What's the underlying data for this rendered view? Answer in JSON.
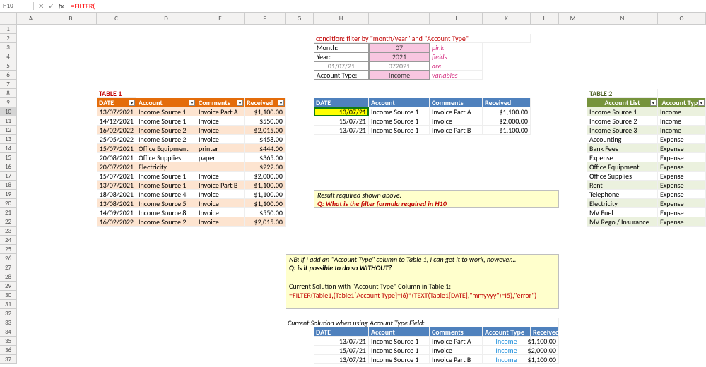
{
  "namebox": "H10",
  "formula": "=FILTER(",
  "cols": [
    "A",
    "B",
    "C",
    "D",
    "E",
    "F",
    "G",
    "H",
    "I",
    "J",
    "K",
    "L",
    "M",
    "N",
    "O"
  ],
  "rows": [
    "1",
    "2",
    "3",
    "4",
    "5",
    "6",
    "7",
    "8",
    "9",
    "10",
    "11",
    "12",
    "13",
    "14",
    "15",
    "16",
    "17",
    "18",
    "19",
    "20",
    "21",
    "22",
    "23",
    "24",
    "25",
    "26",
    "27",
    "28",
    "29",
    "30",
    "31",
    "32",
    "33",
    "34",
    "35",
    "36",
    "37"
  ],
  "condition_title": "condition: filter by \"month/year\" and \"Account Type\"",
  "cond": {
    "month_label": "Month:",
    "month_val": "07",
    "note1": "pink",
    "year_label": "Year:",
    "year_val": "2021",
    "note2": "fields",
    "date_label": "01/07/21",
    "date_val": "072021",
    "note3": "are",
    "acct_label": "Account Type:",
    "acct_val": "Income",
    "note4": "variables"
  },
  "t1": {
    "title": "TABLE 1",
    "hdr": {
      "date": "DATE",
      "acct": "Account",
      "com": "Comments",
      "rec": "Received"
    },
    "rows": [
      {
        "d": "13/07/2021",
        "a": "Income Source 1",
        "c": "Invoice Part A",
        "r": "$1,100.00"
      },
      {
        "d": "14/12/2021",
        "a": "Income Source 1",
        "c": "Invoice",
        "r": "$550.00"
      },
      {
        "d": "16/02/2022",
        "a": "Income Source 2",
        "c": "Invoice",
        "r": "$2,015.00"
      },
      {
        "d": "25/05/2022",
        "a": "Income Source 2",
        "c": "Invoice",
        "r": "$458.00"
      },
      {
        "d": "15/07/2021",
        "a": "Office Equipment",
        "c": "printer",
        "r": "$444.00"
      },
      {
        "d": "20/08/2021",
        "a": "Office Supplies",
        "c": "paper",
        "r": "$365.00"
      },
      {
        "d": "20/07/2021",
        "a": "Electricity",
        "c": "",
        "r": "$222.00"
      },
      {
        "d": "15/07/2021",
        "a": "Income Source 1",
        "c": "Invoice",
        "r": "$2,000.00"
      },
      {
        "d": "13/07/2021",
        "a": "Income Source 1",
        "c": "Invoice Part B",
        "r": "$1,100.00"
      },
      {
        "d": "18/08/2021",
        "a": "Income Source 4",
        "c": "Invoice",
        "r": "$1,100.00"
      },
      {
        "d": "13/08/2021",
        "a": "Income Source 5",
        "c": "Invoice",
        "r": "$1,100.00"
      },
      {
        "d": "14/09/2021",
        "a": "Income Source 8",
        "c": "Invoice",
        "r": "$550.00"
      },
      {
        "d": "16/02/2022",
        "a": "Income Source 2",
        "c": "Invoice",
        "r": "$2,015.00"
      }
    ]
  },
  "result": {
    "hdr": {
      "date": "DATE",
      "acct": "Account",
      "com": "Comments",
      "rec": "Received"
    },
    "rows": [
      {
        "d": "13/07/21",
        "a": "Income Source 1",
        "c": "Invoice Part A",
        "r": "$1,100.00"
      },
      {
        "d": "15/07/21",
        "a": "Income Source 1",
        "c": "Invoice",
        "r": "$2,000.00"
      },
      {
        "d": "13/07/21",
        "a": "Income Source 1",
        "c": "Invoice Part B",
        "r": "$1,100.00"
      }
    ]
  },
  "note1a": "Result required shown above.",
  "note1b": "Q: What is the filter formula required in H10",
  "t2": {
    "title": "TABLE 2",
    "hdr": {
      "al": "Account List",
      "at": "Account Type"
    },
    "rows": [
      {
        "a": "Income Source 1",
        "t": "Income"
      },
      {
        "a": "Income Source 2",
        "t": "Income"
      },
      {
        "a": "Income Source 3",
        "t": "Income"
      },
      {
        "a": "Accounting",
        "t": "Expense"
      },
      {
        "a": "Bank Fees",
        "t": "Expense"
      },
      {
        "a": "Expense",
        "t": "Expense"
      },
      {
        "a": "Office Equipment",
        "t": "Expense"
      },
      {
        "a": "Office Supplies",
        "t": "Expense"
      },
      {
        "a": "Rent",
        "t": "Expense"
      },
      {
        "a": "Telephone",
        "t": "Expense"
      },
      {
        "a": "Electricity",
        "t": "Expense"
      },
      {
        "a": "MV Fuel",
        "t": "Expense"
      },
      {
        "a": "MV Rego / Insurance",
        "t": "Expense"
      }
    ]
  },
  "nb1": "NB: if I add an \"Account Type\" column to Table 1, I can get it to work, however...",
  "nb2": "Q: is it possible to do so WITHOUT?",
  "nb3": "Current Solution with \"Account Type\" Column in Table 1:",
  "nb4": "=FILTER(Table1,(Table1[Account Type]=I6)*(TEXT(Table1[DATE],\"mmyyyy\")=I5),\"error\")",
  "cs_title": "Current Solution when using Account Type Field:",
  "cs": {
    "hdr": {
      "date": "DATE",
      "acct": "Account",
      "com": "Comments",
      "at": "Account Type",
      "rec": "Received"
    },
    "rows": [
      {
        "d": "13/07/21",
        "a": "Income Source 1",
        "c": "Invoice Part A",
        "t": "Income",
        "r": "$1,100.00"
      },
      {
        "d": "15/07/21",
        "a": "Income Source 1",
        "c": "Invoice",
        "t": "Income",
        "r": "$2,000.00"
      },
      {
        "d": "13/07/21",
        "a": "Income Source 1",
        "c": "Invoice Part B",
        "t": "Income",
        "r": "$1,100.00"
      }
    ]
  }
}
